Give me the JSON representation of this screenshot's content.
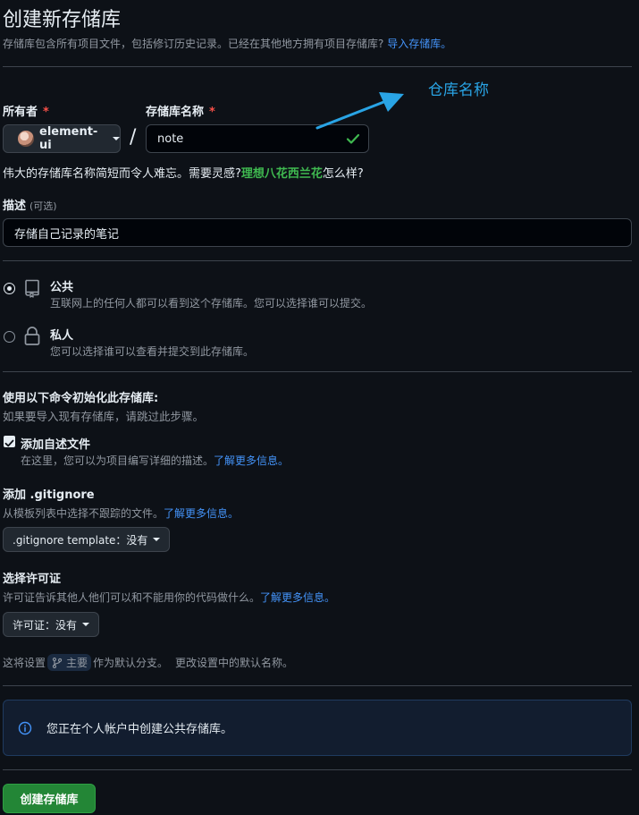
{
  "header": {
    "title": "创建新存储库",
    "subtitle_text": "存储库包含所有项目文件，包括修订历史记录。已经在其他地方拥有项目存储库?",
    "import_link": "导入存储库。"
  },
  "owner": {
    "label": "所有者",
    "required_mark": "*",
    "value": "element-ui",
    "separator": "/"
  },
  "repo_name": {
    "label": "存储库名称",
    "required_mark": "*",
    "value": "note",
    "valid": true
  },
  "annotation": {
    "text": "仓库名称",
    "color": "#29a4e5"
  },
  "name_hint": {
    "prefix": "伟大的存储库名称简短而令人难忘。需要灵感?",
    "suggestion": "理想八花西兰花",
    "suffix": "怎么样?"
  },
  "description": {
    "label": "描述",
    "optional": "(可选)",
    "value": "存储自己记录的笔记"
  },
  "visibility": {
    "selected": "public",
    "public": {
      "title": "公共",
      "desc": "互联网上的任何人都可以看到这个存储库。您可以选择谁可以提交。",
      "icon": "repo-icon"
    },
    "private": {
      "title": "私人",
      "desc": "您可以选择谁可以查看并提交到此存储库。",
      "icon": "lock-icon"
    }
  },
  "init": {
    "title": "使用以下命令初始化此存储库:",
    "subtitle": "如果要导入现有存储库，请跳过此步骤。",
    "readme": {
      "label": "添加自述文件",
      "checked": true,
      "desc": "在这里，您可以为项目编写详细的描述。",
      "link": "了解更多信息。"
    },
    "gitignore": {
      "title": "添加 .gitignore",
      "desc": "从模板列表中选择不跟踪的文件。",
      "link": "了解更多信息。",
      "button": ".gitignore template：没有"
    },
    "license": {
      "title": "选择许可证",
      "desc": "许可证告诉其他人他们可以和不能用你的代码做什么。",
      "link": "了解更多信息。",
      "button": "许可证：没有"
    },
    "branch": {
      "prefix": "这将设置",
      "branch_name": "主要",
      "middle": "作为默认分支。",
      "suffix": "更改设置中的默认名称。"
    }
  },
  "info": {
    "text": "您正在个人帐户中创建公共存储库。"
  },
  "submit": {
    "label": "创建存储库",
    "color": "#238636"
  },
  "colors": {
    "background": "#0d1117",
    "link": "#4493f8",
    "success": "#3fb950",
    "danger": "#f85149"
  }
}
